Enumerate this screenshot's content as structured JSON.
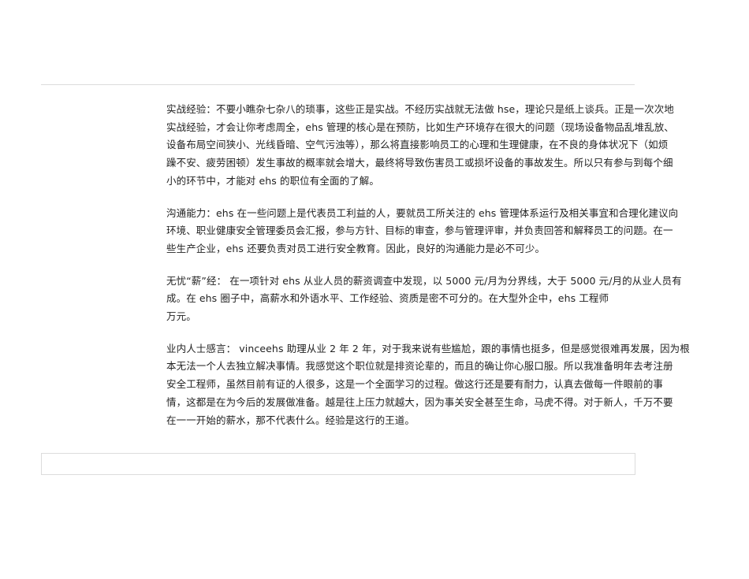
{
  "article": {
    "paragraphs": [
      {
        "lines": [
          "实战经验：不要小瞧杂七杂八的琐事，这些正是实战。不经历实战就无法做 hse，理论只是纸上谈兵。正是一次次地",
          "实战经验，才会让你考虑周全，ehs 管理的核心是在预防，比如生产环境存在很大的问题（现场设备物品乱堆乱放、",
          "设备布局空间狭小、光线昏暗、空气污浊等），那么将直接影响员工的心理和生理健康，在不良的身体状况下（如烦",
          "躁不安、疲劳困顿）发生事故的概率就会增大，最终将导致伤害员工或损坏设备的事故发生。所以只有参与到每个细",
          "小的环节中，才能对 ehs 的职位有全面的了解。"
        ]
      },
      {
        "lines": [
          "沟通能力：ehs 在一些问题上是代表员工利益的人，要就员工所关注的 ehs 管理体系运行及相关事宜和合理化建议向",
          "环境、职业健康安全管理委员会汇报，参与方针、目标的审查，参与管理评审，并负责回答和解释员工的问题。在一",
          "些生产企业，ehs 还要负责对员工进行安全教育。因此，良好的沟通能力是必不可少。"
        ]
      },
      {
        "lines": [
          "无忧“薪”经： 在一项针对 ehs 从业人员的薪资调查中发现，以 5000 元/月为分界线，大于 5000 元/月的从业人员有",
          "成。在 ehs 圈子中，高薪水和外语水平、工作经验、资质是密不可分的。在大型外企中，ehs 工程师",
          "万元。"
        ]
      },
      {
        "lines": [
          "业内人士感言： vinceehs 助理从业 2 年 2 年，对于我来说有些尴尬，跟的事情也挺多，但是感觉很难再发展，因为根",
          "本无法一个人去独立解决事情。我感觉这个职位就是排资论辈的，而且的确让你心服口服。所以我准备明年去考注册",
          "安全工程师，虽然目前有证的人很多，这是一个全面学习的过程。做这行还是要有耐力，认真去做每一件眼前的事",
          "情，这都是在为今后的发展做准备。越是往上压力就越大，因为事关安全甚至生命，马虎不得。对于新人，千万不要",
          "在一一开始的薪水，那不代表什么。经验是这行的王道。"
        ]
      }
    ]
  }
}
